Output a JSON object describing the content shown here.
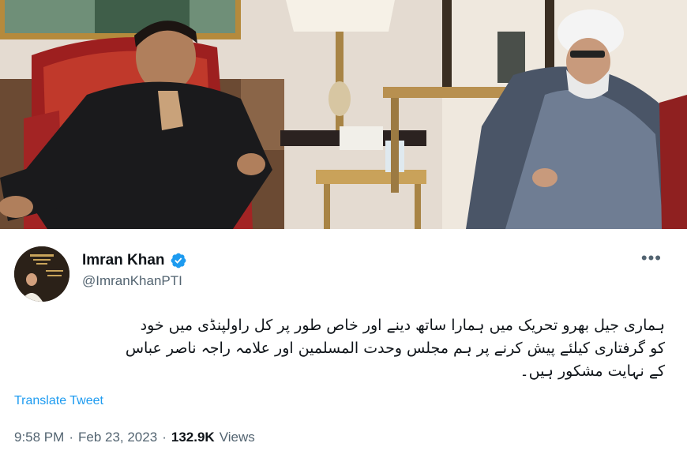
{
  "tweet": {
    "display_name": "Imran Khan",
    "handle": "@ImranKhanPTI",
    "more_label": "•••",
    "text_lines": [
      "ہماری جیل بھرو تحریک میں ہمارا ساتھ دینے اور خاص طور پر کل راولپنڈی میں خود",
      "کو گرفتاری کیلئے پیش کرنے پر ہم مجلس وحدت المسلمین اور علامہ راجہ ناصر عباس",
      "کے نہایت مشکور ہیں۔"
    ],
    "translate_label": "Translate Tweet",
    "time": "9:58 PM",
    "separator": "·",
    "date": "Feb 23, 2023",
    "views_count": "132.9K",
    "views_label": "Views"
  },
  "colors": {
    "accent": "#1d9bf0",
    "text_primary": "#0f1419",
    "text_secondary": "#536471"
  },
  "icons": {
    "verified": "verified-badge-icon",
    "more": "more-options-icon"
  }
}
